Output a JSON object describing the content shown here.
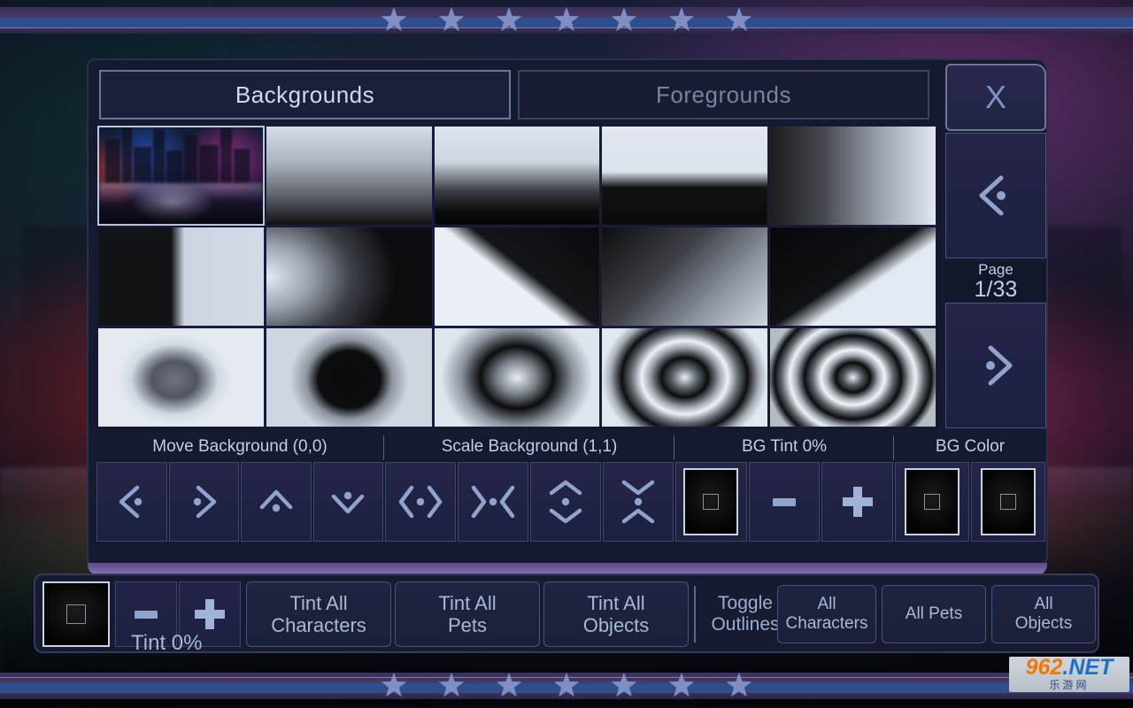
{
  "app": {
    "background_description": "blurred neon city skyline at night",
    "accent_border": "#6d7899",
    "panel_bg": "#151a30",
    "text_color": "#c3cde6"
  },
  "decoration": {
    "star_count": 7,
    "star_color": "#7e8fc4",
    "band_stripe_colors": [
      "#3b3058",
      "#2f4f8c",
      "#3a3258"
    ]
  },
  "dialog": {
    "tabs": [
      {
        "label": "Backgrounds",
        "active": true
      },
      {
        "label": "Foregrounds",
        "active": false
      }
    ],
    "close_button": {
      "label": "X",
      "icon": "close-icon"
    },
    "pager": {
      "prev_icon": "chevron-left-dot-icon",
      "next_icon": "chevron-right-dot-icon",
      "page_word": "Page",
      "page_value": "1/33",
      "current_page": 1,
      "total_pages": 33
    },
    "grid": {
      "columns": 5,
      "rows": 3,
      "items": [
        {
          "name": "neon-city-skyline",
          "art": "a-city",
          "selected": true
        },
        {
          "name": "vertical-gradient-light-to-dark",
          "art": "a-g1",
          "selected": false
        },
        {
          "name": "vertical-gradient-hard-edge",
          "art": "a-g2",
          "selected": false
        },
        {
          "name": "vertical-gradient-sharp-split",
          "art": "a-g3",
          "selected": false
        },
        {
          "name": "horizontal-gradient-dark-to-light",
          "art": "a-g4",
          "selected": false
        },
        {
          "name": "vertical-split-black-white",
          "art": "a-split",
          "selected": false
        },
        {
          "name": "radial-gradient-left-edge",
          "art": "a-radL",
          "selected": false
        },
        {
          "name": "diagonal-wedge-up-right",
          "art": "a-wedge1",
          "selected": false
        },
        {
          "name": "diagonal-gradient-corner",
          "art": "a-diagBR",
          "selected": false
        },
        {
          "name": "diagonal-wedge-down-right",
          "art": "a-wedge3",
          "selected": false
        },
        {
          "name": "soft-dark-blob-center",
          "art": "a-blob1",
          "selected": false
        },
        {
          "name": "large-dark-ellipse",
          "art": "a-blob2",
          "selected": false
        },
        {
          "name": "single-ring-radial",
          "art": "a-ring1",
          "selected": false
        },
        {
          "name": "double-ring-radial",
          "art": "a-ring2",
          "selected": false
        },
        {
          "name": "triple-ring-radial",
          "art": "a-ring3",
          "selected": false
        }
      ]
    },
    "controls": {
      "move": {
        "header": "Move Background (0,0)",
        "value": "(0,0)",
        "buttons": [
          {
            "name": "move-left",
            "icon": "chevron-left-dot-icon"
          },
          {
            "name": "move-right",
            "icon": "chevron-right-dot-icon"
          },
          {
            "name": "move-up",
            "icon": "chevron-up-dot-icon"
          },
          {
            "name": "move-down",
            "icon": "chevron-down-dot-icon"
          }
        ]
      },
      "scale": {
        "header": "Scale Background (1,1)",
        "value": "(1,1)",
        "buttons": [
          {
            "name": "scale-width-expand",
            "icon": "expand-horizontal-icon"
          },
          {
            "name": "scale-width-shrink",
            "icon": "collapse-horizontal-icon"
          },
          {
            "name": "scale-height-expand",
            "icon": "expand-vertical-icon"
          },
          {
            "name": "scale-height-shrink",
            "icon": "collapse-vertical-icon"
          }
        ]
      },
      "bg_tint": {
        "header": "BG Tint 0%",
        "value": "0%",
        "swatch_color": "#000000",
        "minus_label": "-",
        "plus_label": "+"
      },
      "bg_color": {
        "header": "BG Color",
        "swatch_a_color": "#000000",
        "swatch_b_color": "#000000"
      }
    }
  },
  "bottombar": {
    "tint_swatch_color": "#000000",
    "tint_overlay_label": "Tint 0%",
    "tint_value": "0%",
    "minus_label": "-",
    "plus_label": "+",
    "tint_all_buttons": [
      {
        "name": "tint-all-characters",
        "line1": "Tint All",
        "line2": "Characters"
      },
      {
        "name": "tint-all-pets",
        "line1": "Tint All",
        "line2": "Pets"
      },
      {
        "name": "tint-all-objects",
        "line1": "Tint All",
        "line2": "Objects"
      }
    ],
    "toggle_outlines_label": {
      "line1": "Toggle",
      "line2": "Outlines"
    },
    "outline_buttons": [
      {
        "name": "outline-all-characters",
        "line1": "All",
        "line2": "Characters"
      },
      {
        "name": "outline-all-pets",
        "line1": "All Pets",
        "line2": ""
      },
      {
        "name": "outline-all-objects",
        "line1": "All",
        "line2": "Objects"
      }
    ]
  },
  "watermark": {
    "digits": "962",
    "suffix": ".NET",
    "subtitle": "乐游网"
  }
}
